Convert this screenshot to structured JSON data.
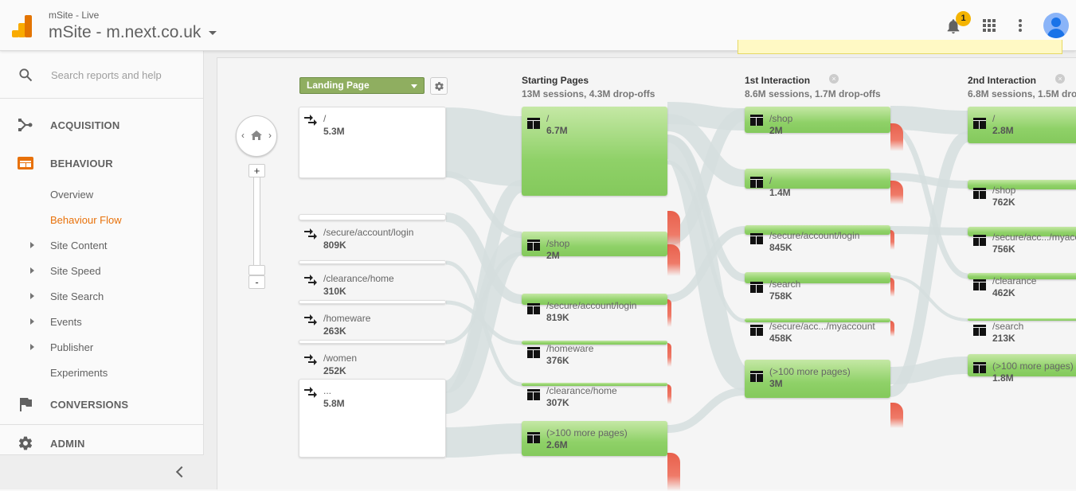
{
  "header": {
    "account_sub": "mSite - Live",
    "account_title": "mSite - m.next.co.uk",
    "notification_count": "1",
    "icons": [
      "analytics-logo",
      "bell-icon",
      "apps-grid-icon",
      "more-vert-icon",
      "avatar"
    ]
  },
  "sidebar": {
    "search_placeholder": "Search reports and help",
    "sections": [
      {
        "label": "ACQUISITION",
        "icon": "acquisition-icon"
      },
      {
        "label": "BEHAVIOUR",
        "icon": "behaviour-icon",
        "active": true
      },
      {
        "label": "CONVERSIONS",
        "icon": "flag-icon"
      },
      {
        "label": "ADMIN",
        "icon": "gear-icon"
      }
    ],
    "behaviour_items": [
      {
        "label": "Overview",
        "expandable": false
      },
      {
        "label": "Behaviour Flow",
        "expandable": false,
        "selected": true
      },
      {
        "label": "Site Content",
        "expandable": true
      },
      {
        "label": "Site Speed",
        "expandable": true
      },
      {
        "label": "Site Search",
        "expandable": true
      },
      {
        "label": "Events",
        "expandable": true
      },
      {
        "label": "Publisher",
        "expandable": true
      },
      {
        "label": "Experiments",
        "expandable": false
      }
    ]
  },
  "colors": {
    "accent": "#e8710a",
    "node_green": "#8fd168",
    "dropoff_red": "#e8604c",
    "dimension_select": "#8fae60",
    "notice_bg": "#fff9c4"
  },
  "flow": {
    "dimension_select": "Landing Page",
    "zoom_level": 0,
    "landing_pages": [
      {
        "name": "/",
        "value": "5.3M"
      },
      {
        "name": "/secure/account/login",
        "value": "809K"
      },
      {
        "name": "/clearance/home",
        "value": "310K"
      },
      {
        "name": "/homeware",
        "value": "263K"
      },
      {
        "name": "/women",
        "value": "252K"
      },
      {
        "name": "...",
        "value": "5.8M"
      }
    ],
    "columns": [
      {
        "title": "Starting Pages",
        "summary": "13M sessions, 4.3M drop-offs",
        "closable": false,
        "nodes": [
          {
            "name": "/",
            "value": "6.7M"
          },
          {
            "name": "/shop",
            "value": "2M"
          },
          {
            "name": "/secure/account/login",
            "value": "819K"
          },
          {
            "name": "/homeware",
            "value": "376K"
          },
          {
            "name": "/clearance/home",
            "value": "307K"
          },
          {
            "name": "(>100 more pages)",
            "value": "2.6M"
          }
        ]
      },
      {
        "title": "1st Interaction",
        "summary": "8.6M sessions, 1.7M drop-offs",
        "closable": true,
        "nodes": [
          {
            "name": "/shop",
            "value": "2M"
          },
          {
            "name": "/",
            "value": "1.4M"
          },
          {
            "name": "/secure/account/login",
            "value": "845K"
          },
          {
            "name": "/search",
            "value": "758K"
          },
          {
            "name": "/secure/acc.../myaccount",
            "value": "458K"
          },
          {
            "name": "(>100 more pages)",
            "value": "3M"
          }
        ]
      },
      {
        "title": "2nd Interaction",
        "summary": "6.8M sessions, 1.5M drop-offs",
        "closable": true,
        "nodes": [
          {
            "name": "/",
            "value": "2.8M"
          },
          {
            "name": "/shop",
            "value": "762K"
          },
          {
            "name": "/secure/acc.../myaccount",
            "value": "756K"
          },
          {
            "name": "/clearance",
            "value": "462K"
          },
          {
            "name": "/search",
            "value": "213K"
          },
          {
            "name": "(>100 more pages)",
            "value": "1.8M"
          }
        ]
      }
    ]
  }
}
